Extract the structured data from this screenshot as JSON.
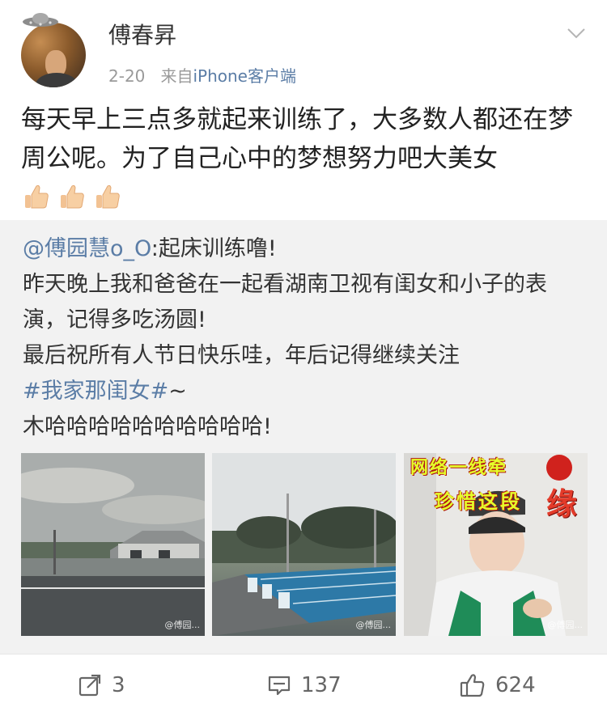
{
  "post": {
    "username": "傅春昇",
    "date": "2-20",
    "source_prefix": "来自",
    "source": "iPhone客户端",
    "text": "每天早上三点多就起来训练了，大多数人都还在梦周公呢。为了自己心中的梦想努力吧大美女",
    "emoji": [
      "thumbs-up-icon",
      "thumbs-up-icon",
      "thumbs-up-icon"
    ]
  },
  "repost": {
    "mention": "@傅园慧o_O",
    "line1_rest": ":起床训练噜!",
    "line2": "昨天晚上我和爸爸在一起看湖南卫视有闺女和小子的表演，记得多吃汤圆!",
    "line3": "最后祝所有人节日快乐哇，年后记得继续关注",
    "hashtag": "#我家那闺女#",
    "hashtag_suffix": "~",
    "line5": "木哈哈哈哈哈哈哈哈哈哈!",
    "images": [
      {
        "name": "street-photo",
        "watermark": "@傅园..."
      },
      {
        "name": "pool-photo",
        "watermark": "@傅园..."
      },
      {
        "name": "selfie-photo",
        "overlay_top": "网络一线牵",
        "overlay_bottom": "珍惜这段",
        "overlay_big": "缘",
        "watermark": "@傅园..."
      }
    ]
  },
  "actions": {
    "repost_count": "3",
    "comment_count": "137",
    "like_count": "624"
  },
  "colors": {
    "link": "#5b7da6",
    "repost_bg": "#f2f2f2"
  }
}
